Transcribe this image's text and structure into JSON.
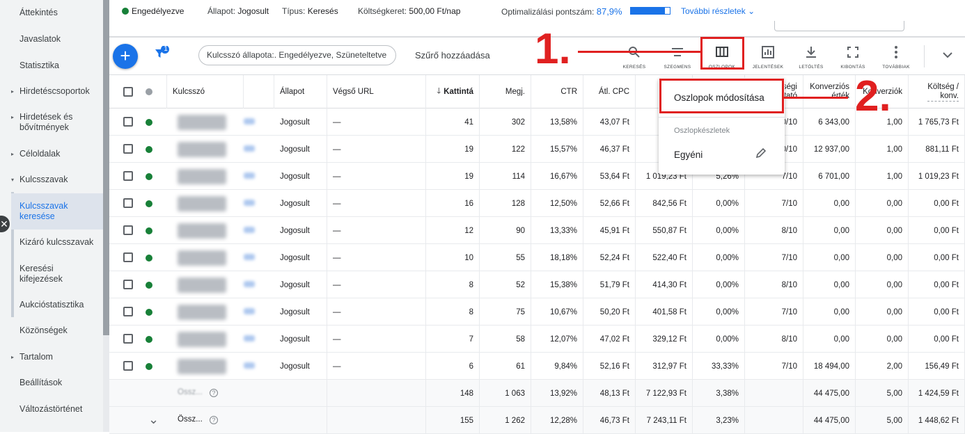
{
  "sidebar": {
    "items": [
      {
        "label": "Áttekintés",
        "caret": false
      },
      {
        "label": "Javaslatok",
        "caret": false
      },
      {
        "label": "Statisztika",
        "caret": false
      },
      {
        "label": "Hirdetéscsoportok",
        "caret": true
      },
      {
        "label": "Hirdetések és bővítmények",
        "caret": true
      },
      {
        "label": "Céloldalak",
        "caret": true
      },
      {
        "label": "Kulcsszavak",
        "caret": true,
        "expanded": true
      }
    ],
    "subitems": [
      {
        "label": "Kulcsszavak keresése",
        "active": true
      },
      {
        "label": "Kizáró kulcsszavak",
        "active": false
      },
      {
        "label": "Keresési kifejezések",
        "active": false
      },
      {
        "label": "Aukcióstatisztika",
        "active": false
      }
    ],
    "items2": [
      {
        "label": "Közönségek",
        "caret": false
      },
      {
        "label": "Tartalom",
        "caret": true
      },
      {
        "label": "Beállítások",
        "caret": false
      },
      {
        "label": "Változástörténet",
        "caret": false
      }
    ]
  },
  "status_bar": {
    "status": "Engedélyezve",
    "state_label": "Állapot:",
    "state_value": "Jogosult",
    "type_label": "Típus:",
    "type_value": "Keresés",
    "budget_label": "Költségkeret:",
    "budget_value": "500,00 Ft/nap",
    "opt_label": "Optimalizálási pontszám:",
    "opt_value": "87,9%",
    "opt_fraction": 0.879,
    "more_details": "További részletek"
  },
  "toolbar": {
    "filter_badge": "1",
    "filter_chip": "Kulcsszó állapota:. Engedélyezve, Szüneteltetve",
    "add_filter": "Szűrő hozzáadása",
    "tools": [
      {
        "label": "KERESÉS",
        "icon": "search-icon"
      },
      {
        "label": "SZEGMENS",
        "icon": "segment-icon"
      },
      {
        "label": "OSZLOPOK",
        "icon": "columns-icon"
      },
      {
        "label": "JELENTÉSEK",
        "icon": "reports-icon"
      },
      {
        "label": "LETÖLTÉS",
        "icon": "download-icon"
      },
      {
        "label": "KIBONTÁS",
        "icon": "expand-icon"
      },
      {
        "label": "TOVÁBBIAK",
        "icon": "more-icon"
      }
    ]
  },
  "annotations": {
    "step1": "1.",
    "step2": "2."
  },
  "columns_menu": {
    "modify": "Oszlopok módosítása",
    "sets_header": "Oszlopkészletek",
    "custom": "Egyéni"
  },
  "table": {
    "headers": {
      "keyword": "Kulcsszó",
      "status": "Állapot",
      "final_url": "Végső URL",
      "clicks": "Kattintá",
      "impr": "Megj.",
      "ctr": "CTR",
      "avg_cpc": "Átl. CPC",
      "quality_a": "ségi",
      "quality_b": "tató",
      "conv_value_a": "Konverziós",
      "conv_value_b": "érték",
      "conversions": "Konverziók",
      "cost_per_conv_a": "Költség /",
      "cost_per_conv_b": "konv."
    },
    "rows": [
      {
        "status": "Jogosult",
        "url": "—",
        "clicks": "41",
        "impr": "302",
        "ctr": "13,58%",
        "cpc": "43,07 Ft",
        "cost": "1 7",
        "conv_rate": "",
        "quality": "0/10",
        "conv_value": "6 343,00",
        "conv": "1,00",
        "cpconv": "1 765,73 Ft",
        "icon": "#188038"
      },
      {
        "status": "Jogosult",
        "url": "—",
        "clicks": "19",
        "impr": "122",
        "ctr": "15,57%",
        "cpc": "46,37 Ft",
        "cost": "8",
        "conv_rate": "",
        "quality": "0/10",
        "conv_value": "12 937,00",
        "conv": "1,00",
        "cpconv": "881,11 Ft",
        "icon": "#188038"
      },
      {
        "status": "Jogosult",
        "url": "—",
        "clicks": "19",
        "impr": "114",
        "ctr": "16,67%",
        "cpc": "53,64 Ft",
        "cost": "1 019,23 Ft",
        "conv_rate": "5,26%",
        "quality": "7/10",
        "conv_value": "6 701,00",
        "conv": "1,00",
        "cpconv": "1 019,23 Ft",
        "icon": "#188038"
      },
      {
        "status": "Jogosult",
        "url": "—",
        "clicks": "16",
        "impr": "128",
        "ctr": "12,50%",
        "cpc": "52,66 Ft",
        "cost": "842,56 Ft",
        "conv_rate": "0,00%",
        "quality": "7/10",
        "conv_value": "0,00",
        "conv": "0,00",
        "cpconv": "0,00 Ft",
        "icon": "#188038"
      },
      {
        "status": "Jogosult",
        "url": "—",
        "clicks": "12",
        "impr": "90",
        "ctr": "13,33%",
        "cpc": "45,91 Ft",
        "cost": "550,87 Ft",
        "conv_rate": "0,00%",
        "quality": "8/10",
        "conv_value": "0,00",
        "conv": "0,00",
        "cpconv": "0,00 Ft",
        "icon": "#188038"
      },
      {
        "status": "Jogosult",
        "url": "—",
        "clicks": "10",
        "impr": "55",
        "ctr": "18,18%",
        "cpc": "52,24 Ft",
        "cost": "522,40 Ft",
        "conv_rate": "0,00%",
        "quality": "7/10",
        "conv_value": "0,00",
        "conv": "0,00",
        "cpconv": "0,00 Ft",
        "icon": "#188038"
      },
      {
        "status": "Jogosult",
        "url": "—",
        "clicks": "8",
        "impr": "52",
        "ctr": "15,38%",
        "cpc": "51,79 Ft",
        "cost": "414,30 Ft",
        "conv_rate": "0,00%",
        "quality": "8/10",
        "conv_value": "0,00",
        "conv": "0,00",
        "cpconv": "0,00 Ft",
        "icon": "#188038"
      },
      {
        "status": "Jogosult",
        "url": "—",
        "clicks": "8",
        "impr": "75",
        "ctr": "10,67%",
        "cpc": "50,20 Ft",
        "cost": "401,58 Ft",
        "conv_rate": "0,00%",
        "quality": "7/10",
        "conv_value": "0,00",
        "conv": "0,00",
        "cpconv": "0,00 Ft",
        "icon": "#188038"
      },
      {
        "status": "Jogosult",
        "url": "—",
        "clicks": "7",
        "impr": "58",
        "ctr": "12,07%",
        "cpc": "47,02 Ft",
        "cost": "329,12 Ft",
        "conv_rate": "0,00%",
        "quality": "8/10",
        "conv_value": "0,00",
        "conv": "0,00",
        "cpconv": "0,00 Ft",
        "icon": "#188038"
      },
      {
        "status": "Jogosult",
        "url": "—",
        "clicks": "6",
        "impr": "61",
        "ctr": "9,84%",
        "cpc": "52,16 Ft",
        "cost": "312,97 Ft",
        "conv_rate": "33,33%",
        "quality": "7/10",
        "conv_value": "18 494,00",
        "conv": "2,00",
        "cpconv": "156,49 Ft",
        "icon": "#188038"
      }
    ],
    "totals": [
      {
        "label": "Össz...",
        "clicks": "148",
        "impr": "1 063",
        "ctr": "13,92%",
        "cpc": "48,13 Ft",
        "cost": "7 122,93 Ft",
        "conv_rate": "3,38%",
        "conv_value": "44 475,00",
        "conv": "5,00",
        "cpconv": "1 424,59 Ft"
      },
      {
        "label": "Össz...",
        "clicks": "155",
        "impr": "1 262",
        "ctr": "12,28%",
        "cpc": "46,73 Ft",
        "cost": "7 243,11 Ft",
        "conv_rate": "3,23%",
        "conv_value": "44 475,00",
        "conv": "5,00",
        "cpconv": "1 448,62 Ft"
      }
    ]
  }
}
